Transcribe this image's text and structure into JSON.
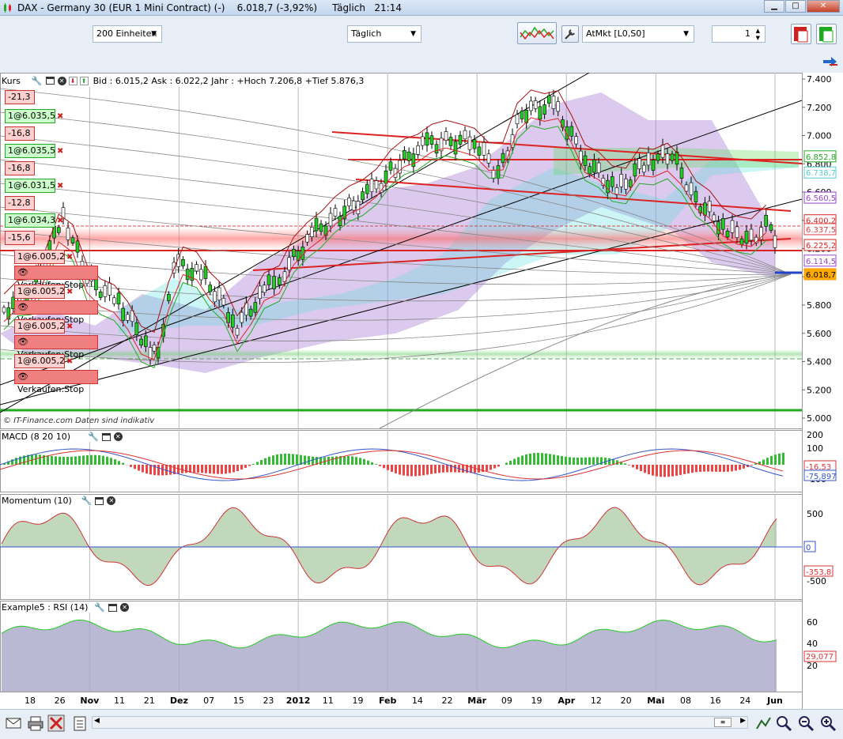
{
  "window": {
    "title": "DAX - Germany 30 (EUR 1 Mini Contract) (-)",
    "price": "6.018,7 (-3,92%)",
    "period": "Täglich",
    "time": "21:14"
  },
  "toolbar": {
    "units_select": "200 Einheiten",
    "interval_select": "Täglich",
    "order_type_select": "AtMkt [L0,S0]",
    "quantity": "1"
  },
  "main_panel": {
    "name": "Kurs",
    "info": "Bid : 6.015,2  Ask : 6.022,2  Jahr : +Hoch 7.206,8  +Tief 5.876,3",
    "copyright": "© IT-Finance.com  Daten sind indikativ",
    "y_labels": [
      "7.400",
      "7.200",
      "7.000",
      "6.800",
      "6.600",
      "6.400",
      "6.200",
      "6.000",
      "5.800",
      "5.600",
      "5.400",
      "5.200",
      "5.000"
    ],
    "price_tags": [
      {
        "text": "6.852,8",
        "color": "#22aa22"
      },
      {
        "text": "6.738,7",
        "color": "#55cccc"
      },
      {
        "text": "6.560,5",
        "color": "#9944cc"
      },
      {
        "text": "6.400,2",
        "color": "#dd2222"
      },
      {
        "text": "6.337,5",
        "color": "#dd4444"
      },
      {
        "text": "6.225,2",
        "color": "#dd2222"
      },
      {
        "text": "6.114,5",
        "color": "#9944cc"
      },
      {
        "text": "6.018,7",
        "color": "#ff9900"
      }
    ]
  },
  "orders": [
    {
      "label": "-21,3"
    },
    {
      "label": "1@6.035,5",
      "pnl": "-16,8"
    },
    {
      "label": "1@6.035,5",
      "pnl": "-16,8"
    },
    {
      "label": "1@6.031,5",
      "pnl": "-12,8"
    },
    {
      "label": "1@6.034,3",
      "pnl": "-15,6"
    }
  ],
  "stop_orders": [
    {
      "label": "1@6.005,2",
      "action": "Verkaufen:Stop"
    },
    {
      "label": "1@6.005,2",
      "action": "Verkaufen:Stop"
    },
    {
      "label": "1@6.005,2",
      "action": "Verkaufen:Stop"
    },
    {
      "label": "1@6.005,2",
      "action": "Verkaufen:Stop"
    }
  ],
  "macd_panel": {
    "name": "MACD (8 20 10)",
    "y_labels": [
      "200",
      "100",
      "0",
      "-100"
    ],
    "tags": [
      {
        "text": "-16,53",
        "color": "#dd3333"
      },
      {
        "text": "-75,897",
        "color": "#3355cc"
      }
    ]
  },
  "momentum_panel": {
    "name": "Momentum (10)",
    "y_labels": [
      "500",
      "0",
      "-500"
    ],
    "tags": [
      {
        "text": "0",
        "color": "#3355cc"
      },
      {
        "text": "-353,8",
        "color": "#dd3333"
      }
    ]
  },
  "rsi_panel": {
    "name": "Example5 : RSI (14)",
    "y_labels": [
      "60",
      "40",
      "20"
    ],
    "tags": [
      {
        "text": "29,077",
        "color": "#dd3333"
      }
    ]
  },
  "x_axis": [
    "18",
    "26",
    "Nov",
    "11",
    "21",
    "Dez",
    "07",
    "15",
    "23",
    "2012",
    "11",
    "19",
    "Feb",
    "14",
    "22",
    "Mär",
    "09",
    "19",
    "Apr",
    "12",
    "20",
    "Mai",
    "08",
    "16",
    "24",
    "Jun"
  ]
}
